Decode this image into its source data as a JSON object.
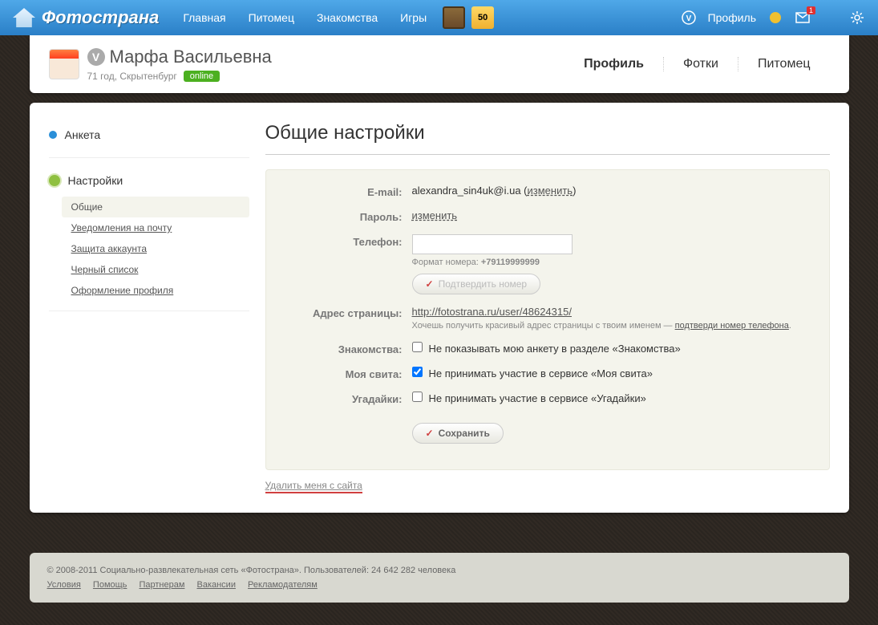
{
  "top": {
    "logo": "Фотострана",
    "nav": [
      "Главная",
      "Питомец",
      "Знакомства",
      "Игры"
    ],
    "profile_label": "Профиль",
    "msg_count": "1",
    "badge50": "50"
  },
  "user": {
    "name": "Марфа Васильевна",
    "sub": "71 год, Скрытенбург",
    "status": "online",
    "tabs": [
      "Профиль",
      "Фотки",
      "Питомец"
    ]
  },
  "sidebar": {
    "anketa": "Анкета",
    "settings": "Настройки",
    "items": [
      "Общие",
      "Уведомления на почту",
      "Защита аккаунта",
      "Черный список",
      "Оформление профиля"
    ]
  },
  "page": {
    "title": "Общие настройки",
    "email_l": "E-mail:",
    "email_v": "alexandra_sin4uk@i.ua",
    "change": "изменить",
    "pass_l": "Пароль:",
    "phone_l": "Телефон:",
    "phone_fmt_pre": "Формат номера: ",
    "phone_fmt": "+79119999999",
    "confirm_btn": "Подтвердить номер",
    "url_l": "Адрес страницы:",
    "url_v": "http://fotostrana.ru/user/48624315/",
    "url_hint_a": "Хочешь получить красивый адрес страницы с твоим именем — ",
    "url_hint_b": "подтверди номер телефона",
    "znak_l": "Знакомства:",
    "znak_t": "Не показывать мою анкету в разделе «Знакомства»",
    "svita_l": "Моя свита:",
    "svita_t": "Не принимать участие в сервисе «Моя свита»",
    "ugad_l": "Угадайки:",
    "ugad_t": "Не принимать участие в сервисе «Угадайки»",
    "save": "Сохранить",
    "delete": "Удалить меня с сайта"
  },
  "footer": {
    "copy": "©  2008-2011 Социально-развлекательная сеть «Фотострана». Пользователей: 24 642 282 человека",
    "links": [
      "Условия",
      "Помощь",
      "Партнерам",
      "Вакансии",
      "Рекламодателям"
    ]
  }
}
